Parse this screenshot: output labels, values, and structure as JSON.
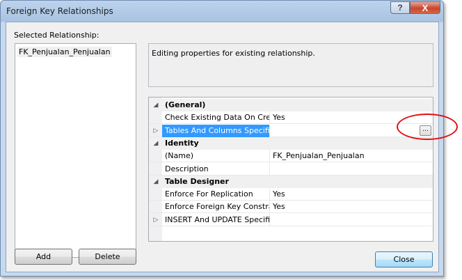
{
  "window": {
    "title": "Foreign Key Relationships",
    "help_glyph": "?",
    "close_glyph": "X"
  },
  "left": {
    "label": "Selected Relationship:",
    "items": [
      "FK_Penjualan_Penjualan"
    ]
  },
  "description": "Editing properties for existing relationship.",
  "grid": {
    "rows": [
      {
        "type": "category",
        "expander": "◢",
        "name": "(General)"
      },
      {
        "type": "item",
        "expander": "",
        "name": "Check Existing Data On Creation",
        "value": "Yes"
      },
      {
        "type": "item",
        "expander": "▷",
        "name": "Tables And Columns Specification",
        "value": "",
        "selected": true,
        "ellipsis": "..."
      },
      {
        "type": "category",
        "expander": "◢",
        "name": "Identity"
      },
      {
        "type": "item",
        "expander": "",
        "name": "(Name)",
        "value": "FK_Penjualan_Penjualan"
      },
      {
        "type": "item",
        "expander": "",
        "name": "Description",
        "value": ""
      },
      {
        "type": "category",
        "expander": "◢",
        "name": "Table Designer"
      },
      {
        "type": "item",
        "expander": "",
        "name": "Enforce For Replication",
        "value": "Yes"
      },
      {
        "type": "item",
        "expander": "",
        "name": "Enforce Foreign Key Constraint",
        "value": "Yes"
      },
      {
        "type": "item",
        "expander": "▷",
        "name": "INSERT And UPDATE Specification",
        "value": ""
      }
    ]
  },
  "buttons": {
    "add": "Add",
    "delete": "Delete",
    "close": "Close"
  },
  "colors": {
    "selection": "#3399ff",
    "annotation": "#e01010",
    "close_caption": "#c8462f"
  }
}
